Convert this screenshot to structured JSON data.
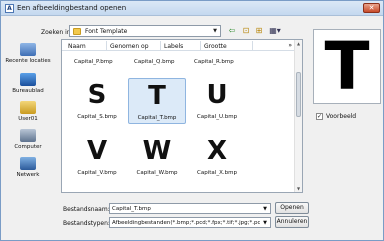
{
  "window": {
    "title": "Een afbeeldingbestand openen",
    "close_label": "✕",
    "app_icon_letter": "A"
  },
  "lookin": {
    "label": "Zoeken in:",
    "value": "Font Template"
  },
  "toolbar": {
    "back": "⇦",
    "up": "⊡",
    "new_folder": "⊞",
    "views": "▦▾"
  },
  "places": [
    {
      "label": "Recente locaties",
      "icon": "recent-icon"
    },
    {
      "label": "Bureaublad",
      "icon": "desktop-icon"
    },
    {
      "label": "User01",
      "icon": "user-folder-icon"
    },
    {
      "label": "Computer",
      "icon": "computer-icon"
    },
    {
      "label": "Netwerk",
      "icon": "network-icon"
    }
  ],
  "columns": {
    "name": "Naam",
    "taken": "Genomen op",
    "labels": "Labels",
    "size": "Grootte",
    "more": "»"
  },
  "partial_files": [
    "Capital_P.bmp",
    "Capital_Q.bmp",
    "Capital_R.bmp"
  ],
  "files": [
    {
      "glyph": "S",
      "name": "Capital_S.bmp",
      "selected": false
    },
    {
      "glyph": "T",
      "name": "Capital_T.bmp",
      "selected": true
    },
    {
      "glyph": "U",
      "name": "Capital_U.bmp",
      "selected": false
    },
    {
      "glyph": "V",
      "name": "Capital_V.bmp",
      "selected": false
    },
    {
      "glyph": "W",
      "name": "Capital_W.bmp",
      "selected": false
    },
    {
      "glyph": "X",
      "name": "Capital_X.bmp",
      "selected": false
    }
  ],
  "preview": {
    "glyph": "T",
    "checkbox_label": "Voorbeeld",
    "checked": "✓"
  },
  "filename": {
    "label": "Bestandsnaam:",
    "value": "Capital_T.bmp"
  },
  "filetype": {
    "label": "Bestandstypen:",
    "value": "Afbeeldingbestanden(*.bmp;*.pcd;*.fpx;*.tif;*.jpg;*.pcx"
  },
  "buttons": {
    "open": "Openen",
    "cancel": "Annuleren"
  },
  "scroll": {
    "up": "▲",
    "down": "▼"
  },
  "combo_arrow": "▼"
}
